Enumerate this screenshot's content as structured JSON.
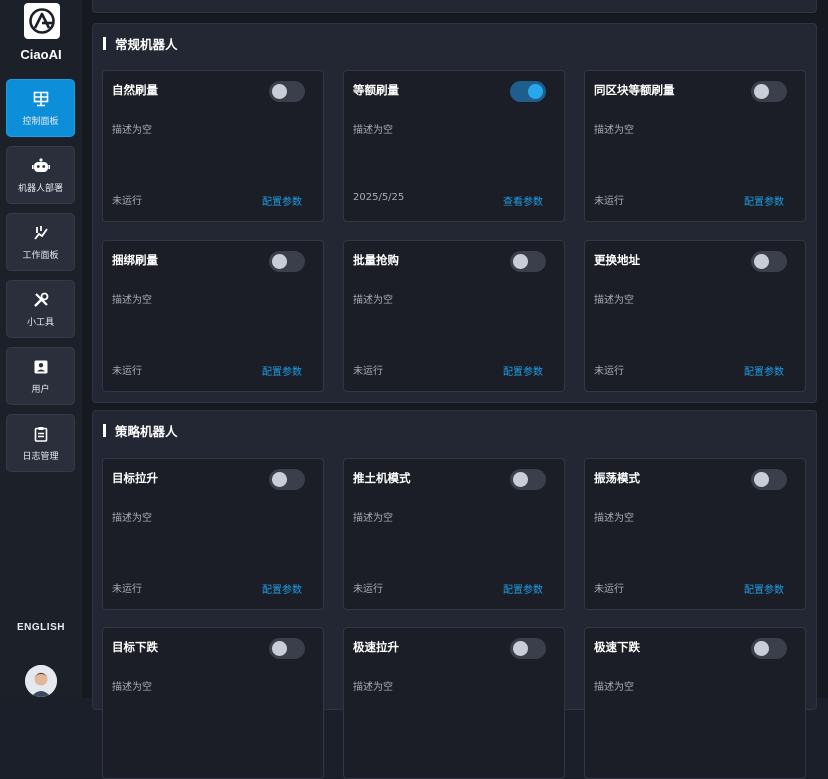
{
  "brand": {
    "name": "CiaoAI"
  },
  "sidebar": {
    "items": [
      {
        "label": "控制面板",
        "icon": "dashboard-icon",
        "active": true
      },
      {
        "label": "机器人部署",
        "icon": "robot-icon",
        "active": false
      },
      {
        "label": "工作面板",
        "icon": "work-panel-icon",
        "active": false
      },
      {
        "label": "小工具",
        "icon": "tools-icon",
        "active": false
      },
      {
        "label": "用户",
        "icon": "user-icon",
        "active": false
      },
      {
        "label": "日志管理",
        "icon": "log-icon",
        "active": false
      }
    ],
    "language": "ENGLISH"
  },
  "sections": [
    {
      "title": "常规机器人",
      "cards": [
        {
          "title": "自然刷量",
          "desc": "描述为空",
          "status": "未运行",
          "action": "配置参数",
          "enabled": false
        },
        {
          "title": "等额刷量",
          "desc": "描述为空",
          "status": "2025/5/25",
          "action": "查看参数",
          "enabled": true
        },
        {
          "title": "同区块等额刷量",
          "desc": "描述为空",
          "status": "未运行",
          "action": "配置参数",
          "enabled": false
        },
        {
          "title": "捆绑刷量",
          "desc": "描述为空",
          "status": "未运行",
          "action": "配置参数",
          "enabled": false
        },
        {
          "title": "批量抢购",
          "desc": "描述为空",
          "status": "未运行",
          "action": "配置参数",
          "enabled": false
        },
        {
          "title": "更换地址",
          "desc": "描述为空",
          "status": "未运行",
          "action": "配置参数",
          "enabled": false
        }
      ]
    },
    {
      "title": "策略机器人",
      "cards": [
        {
          "title": "目标拉升",
          "desc": "描述为空",
          "status": "未运行",
          "action": "配置参数",
          "enabled": false
        },
        {
          "title": "推土机模式",
          "desc": "描述为空",
          "status": "未运行",
          "action": "配置参数",
          "enabled": false
        },
        {
          "title": "振荡模式",
          "desc": "描述为空",
          "status": "未运行",
          "action": "配置参数",
          "enabled": false
        },
        {
          "title": "目标下跌",
          "desc": "描述为空",
          "status": "",
          "action": "",
          "enabled": false
        },
        {
          "title": "极速拉升",
          "desc": "描述为空",
          "status": "",
          "action": "",
          "enabled": false
        },
        {
          "title": "极速下跌",
          "desc": "描述为空",
          "status": "",
          "action": "",
          "enabled": false
        }
      ]
    }
  ],
  "colors": {
    "accent": "#0c8fd8",
    "link": "#1e9de6",
    "toggle_on": "#27a8ee",
    "card_bg": "#1b1e26",
    "panel_bg": "#232733"
  }
}
